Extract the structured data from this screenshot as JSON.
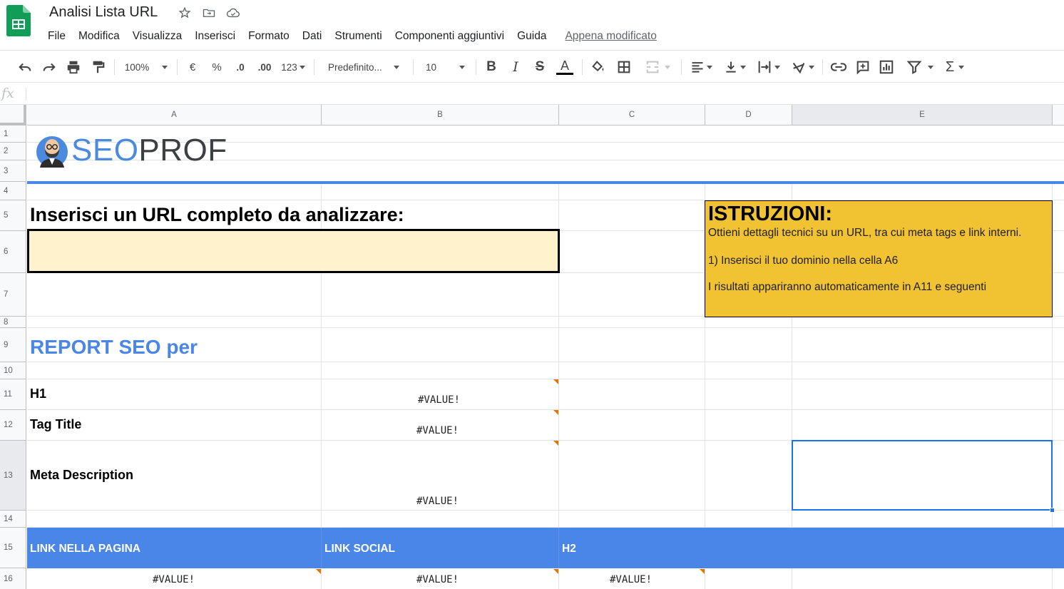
{
  "app": {
    "title": "Analisi Lista URL",
    "icons": [
      "spreadsheet-logo",
      "star-icon",
      "move-folder-icon",
      "cloud-saved-icon"
    ],
    "colors": {
      "brand_green": "#0f9d58",
      "selection_blue": "#1a73e8"
    }
  },
  "menu": {
    "items": [
      "File",
      "Modifica",
      "Visualizza",
      "Inserisci",
      "Formato",
      "Dati",
      "Strumenti",
      "Componenti aggiuntivi",
      "Guida"
    ],
    "last_edit": "Appena modificato"
  },
  "toolbar": {
    "zoom": "100%",
    "currency": "€",
    "percent": "%",
    "decrease_decimals": ".0",
    "increase_decimals": ".00",
    "more_formats": "123",
    "font": "Predefinito...",
    "font_size": "10",
    "icons": [
      "undo-icon",
      "redo-icon",
      "print-icon",
      "paint-format-icon",
      "bold-icon",
      "italic-icon",
      "strikethrough-icon",
      "text-color-icon",
      "fill-color-icon",
      "borders-icon",
      "merge-icon",
      "align-icon",
      "valign-icon",
      "wrap-icon",
      "rotate-icon",
      "link-icon",
      "comment-icon",
      "chart-icon",
      "filter-icon",
      "functions-icon"
    ]
  },
  "formula_bar": {
    "fx": "fx",
    "value": ""
  },
  "grid": {
    "columns": [
      "A",
      "B",
      "C",
      "D",
      "E"
    ],
    "rows": [
      "1",
      "2",
      "3",
      "4",
      "5",
      "6",
      "7",
      "8",
      "9",
      "10",
      "11",
      "12",
      "13",
      "14",
      "15",
      "16"
    ],
    "selected_column": "E",
    "selected_row": "13"
  },
  "sheet": {
    "logo": {
      "seo": "SEO",
      "prof": "PROF"
    },
    "prompt": "Inserisci un URL completo da analizzare:",
    "url_value": "",
    "instructions": {
      "title": "ISTRUZIONI:",
      "line1": "Ottieni dettagli tecnici su un URL, tra cui meta tags e link interni.",
      "line2": "1) Inserisci il tuo dominio nella cella A6",
      "line3": "I risultati appariranno automaticamente in A11 e seguenti"
    },
    "report_title": "REPORT SEO per",
    "labels": {
      "h1": "H1",
      "title": "Tag Title",
      "description": "Meta Description"
    },
    "errors": {
      "b11": "#VALUE!",
      "b12": "#VALUE!",
      "b13": "#VALUE!",
      "a16": "#VALUE!",
      "b16": "#VALUE!",
      "c16": "#VALUE!"
    },
    "headers": {
      "links": "LINK NELLA PAGINA",
      "social": "LINK SOCIAL",
      "h2": "H2"
    },
    "colors": {
      "logo_blue": "#4a8be0",
      "band_blue": "#4a86e8",
      "instructions_yellow": "#f1c232",
      "input_cream": "#fff2cc"
    }
  }
}
